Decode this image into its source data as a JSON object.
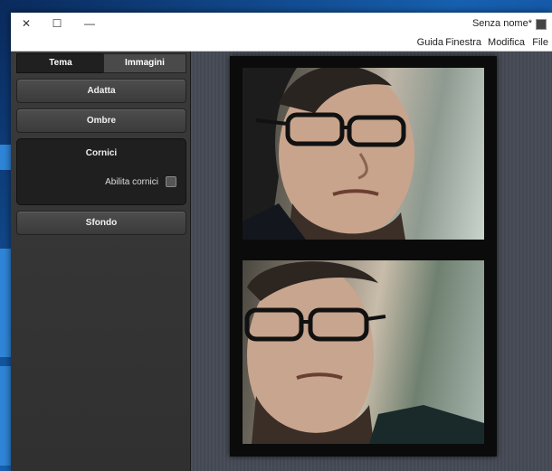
{
  "window": {
    "title": "Senza nome*",
    "controls": {
      "close": "✕",
      "maximize": "☐",
      "minimize": "—"
    }
  },
  "menubar": {
    "items": [
      "File",
      "Modifica",
      "Finestra",
      "Guida"
    ]
  },
  "sidebar": {
    "tabs": [
      "Tema",
      "Immagini"
    ],
    "buttons": {
      "adatta": "Adatta",
      "ombre": "Ombre",
      "sfondo": "Sfondo"
    },
    "cornici": {
      "title": "Cornici",
      "checkbox_label": "Abilita cornici",
      "checked": false
    }
  },
  "colors": {
    "panel": "#333333",
    "canvas": "#484c56",
    "frame": "#0b0b0b"
  }
}
